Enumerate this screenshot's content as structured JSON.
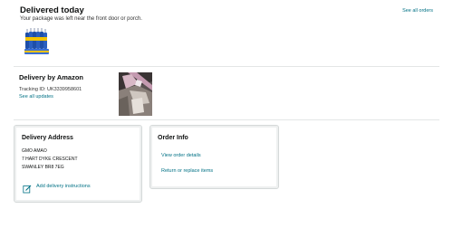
{
  "header": {
    "title": "Delivered today",
    "subtitle": "Your package was left near the front door or porch.",
    "see_all_orders": "See all orders"
  },
  "delivery": {
    "heading": "Delivery by Amazon",
    "tracking_id": "Tracking ID: UK3339958601",
    "see_all_updates": "See all updates"
  },
  "address": {
    "heading": "Delivery Address",
    "lines": [
      "GMO AMAO",
      "7 HART DYKE CRESCENT",
      "SWANLEY BR8 7EG"
    ],
    "add_instructions": "Add delivery instructions"
  },
  "order_info": {
    "heading": "Order Info",
    "view_details": "View order details",
    "return_replace": "Return or replace items"
  },
  "colors": {
    "link": "#007185",
    "border": "#d5d9d9"
  },
  "icons": {
    "edit": "edit-pencil-icon"
  }
}
